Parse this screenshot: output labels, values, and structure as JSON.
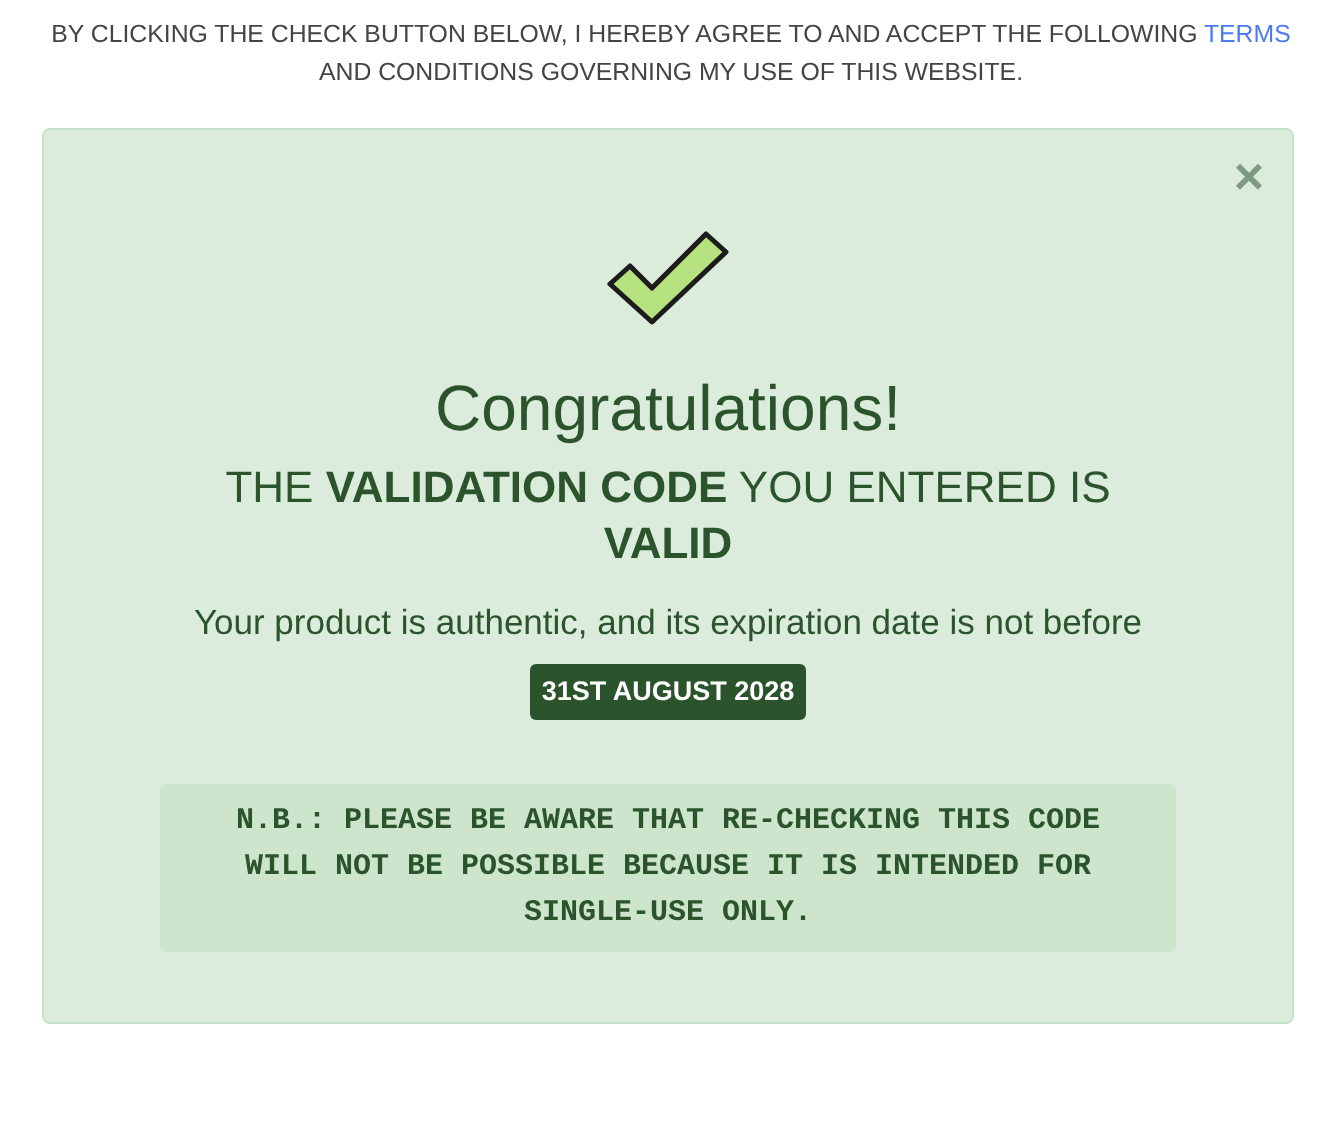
{
  "intro": {
    "before": "BY CLICKING THE CHECK BUTTON BELOW, I HEREBY AGREE TO AND ACCEPT THE FOLLOWING ",
    "link": "TERMS",
    "after": " AND CONDITIONS GOVERNING MY USE OF THIS WEBSITE."
  },
  "result": {
    "close": "×",
    "title": "Congratulations!",
    "headline": "THE **VALIDATION CODE** YOU ENTERED IS **VALID**",
    "message": "Your product is authentic, and its expiration date is not before",
    "date": "31ST AUGUST 2028",
    "note": "N.B.: PLEASE BE AWARE THAT RE-CHECKING THIS CODE WILL NOT BE POSSIBLE BECAUSE IT IS INTENDED FOR SINGLE-USE ONLY."
  }
}
